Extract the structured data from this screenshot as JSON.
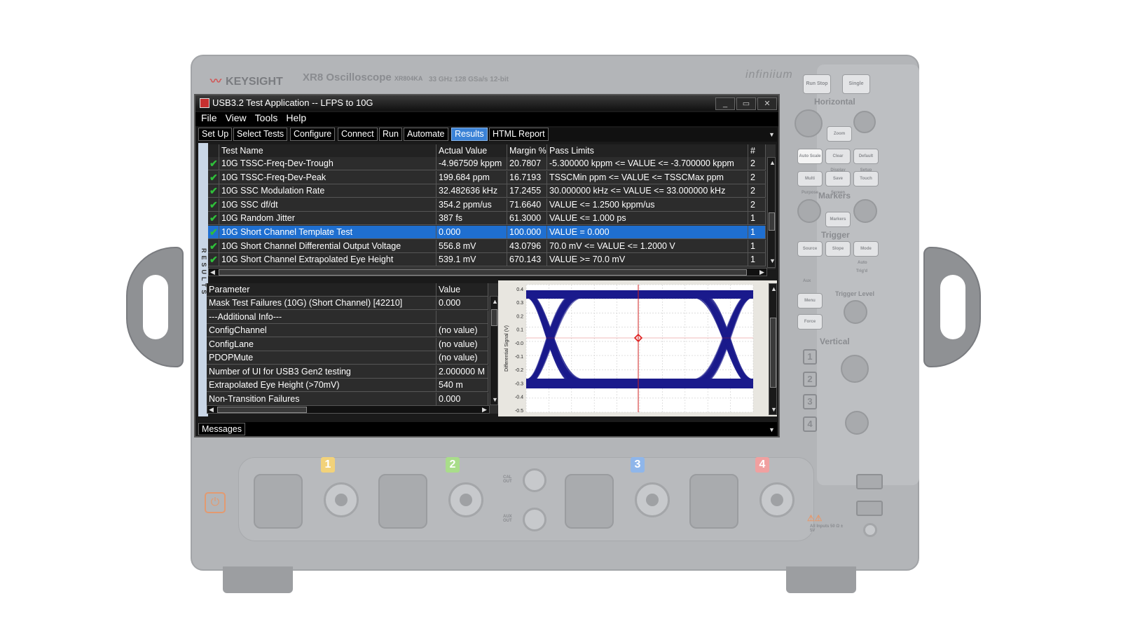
{
  "instrument": {
    "brand": "KEYSIGHT",
    "model": "XR8",
    "model_sub": "Oscilloscope",
    "model_code": "XR804KA",
    "specs": "33 GHz   128 GSa/s   12-bit",
    "series": "infiniium",
    "panel": {
      "run_stop": "Run Stop",
      "single": "Single",
      "horizontal": "Horizontal",
      "zoom": "Zoom",
      "auto_scale": "Auto Scale",
      "clear_display": "Clear Display",
      "default_setup": "Default Setup",
      "multi_purpose": "Multi Purpose",
      "save_screen": "Save Screen",
      "touch": "Touch",
      "markers": "Markers",
      "markers_btn": "Markers",
      "trigger": "Trigger",
      "source": "Source",
      "slope": "Slope",
      "mode": "Mode",
      "trigger_level": "Trigger Level",
      "menu": "Menu",
      "force": "Force",
      "auto": "Auto",
      "trigd": "Trig'd",
      "aux": "Aux",
      "vertical": "Vertical",
      "channels": [
        "1",
        "2",
        "3",
        "4"
      ]
    },
    "front": {
      "channel_labels": [
        "1",
        "2",
        "3",
        "4"
      ],
      "channel_colors": [
        "#f2d27a",
        "#a9dd8a",
        "#8fb6ea",
        "#f0a0a0"
      ],
      "cal_out": "CAL OUT",
      "aux_out": "AUX OUT",
      "warning": "All Inputs 50 Ω ± 5V"
    }
  },
  "app": {
    "title": "USB3.2 Test Application -- LFPS to 10G",
    "menu": [
      "File",
      "View",
      "Tools",
      "Help"
    ],
    "tabs": [
      "Set Up",
      "Select Tests",
      "Configure",
      "Connect",
      "Run",
      "Automate",
      "Results",
      "HTML Report"
    ],
    "active_tab": "Results",
    "side_label": "RESULTS",
    "results_table": {
      "columns": [
        "Test Name",
        "Actual Value",
        "Margin %",
        "Pass Limits",
        "# Tri"
      ],
      "rows": [
        {
          "name": "10G TSSC-Freq-Dev-Trough",
          "actual": "-4.967509 kppm",
          "margin": "20.7807",
          "limits": "-5.300000 kppm <= VALUE <= -3.700000 kppm",
          "trials": "2"
        },
        {
          "name": "10G TSSC-Freq-Dev-Peak",
          "actual": "199.684 ppm",
          "margin": "16.7193",
          "limits": "TSSCMin ppm <= VALUE <= TSSCMax ppm",
          "trials": "2"
        },
        {
          "name": "10G SSC Modulation Rate",
          "actual": "32.482636 kHz",
          "margin": "17.2455",
          "limits": "30.000000 kHz <= VALUE <= 33.000000 kHz",
          "trials": "2"
        },
        {
          "name": "10G SSC df/dt",
          "actual": "354.2 ppm/us",
          "margin": "71.6640",
          "limits": "VALUE <= 1.2500 kppm/us",
          "trials": "2"
        },
        {
          "name": "10G Random Jitter",
          "actual": "387 fs",
          "margin": "61.3000",
          "limits": "VALUE <= 1.000 ps",
          "trials": "1"
        },
        {
          "name": "10G Short Channel Template Test",
          "actual": "0.000",
          "margin": "100.000",
          "limits": "VALUE = 0.000",
          "trials": "1"
        },
        {
          "name": "10G Short Channel Differential Output Voltage",
          "actual": "556.8 mV",
          "margin": "43.0796",
          "limits": "70.0 mV <= VALUE <= 1.2000 V",
          "trials": "1"
        },
        {
          "name": "10G Short Channel Extrapolated Eye Height",
          "actual": "539.1 mV",
          "margin": "670.143",
          "limits": "VALUE >= 70.0 mV",
          "trials": "1"
        }
      ],
      "selected_index": 5
    },
    "param_table": {
      "columns": [
        "Parameter",
        "Value"
      ],
      "rows": [
        {
          "param": "Mask Test Failures (10G) (Short Channel) [42210]",
          "value": "0.000"
        },
        {
          "param": "---Additional Info---",
          "value": ""
        },
        {
          "param": "ConfigChannel",
          "value": "(no value)"
        },
        {
          "param": "ConfigLane",
          "value": "(no value)"
        },
        {
          "param": "PDOPMute",
          "value": "(no value)"
        },
        {
          "param": "Number of UI for USB3 Gen2 testing",
          "value": "2.000000 M"
        },
        {
          "param": "Extrapolated Eye Height (>70mV)",
          "value": "540 m"
        },
        {
          "param": "Non-Transition Failures",
          "value": "0.000"
        }
      ]
    },
    "eye_plot": {
      "ylabel": "Differential Signal (V)",
      "yticks": [
        "0.4",
        "0.3",
        "0.2",
        "0.1",
        "-0.0",
        "-0.1",
        "-0.2",
        "-0.3",
        "-0.4",
        "-0.5"
      ],
      "trace_color": "#1a1a8c"
    },
    "messages_tab": "Messages"
  }
}
